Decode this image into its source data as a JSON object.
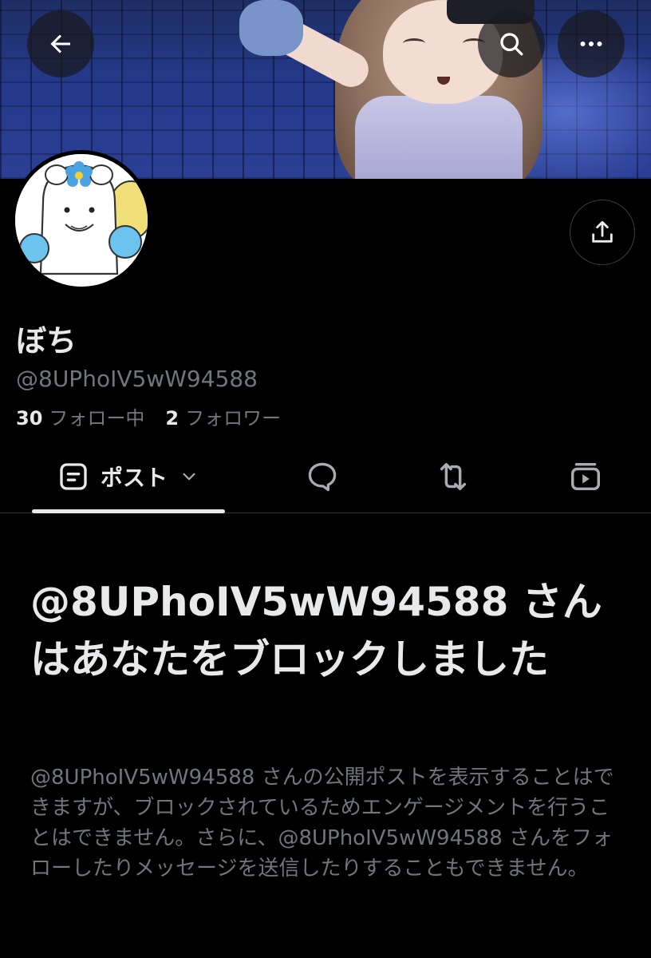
{
  "header": {
    "back_icon": "arrow-left-icon",
    "search_icon": "search-icon",
    "more_icon": "more-horizontal-icon"
  },
  "profile": {
    "display_name": "ぼち",
    "handle": "@8UPhoIV5wW94588",
    "following_count": "30",
    "following_label": "フォロー中",
    "followers_count": "2",
    "followers_label": "フォロワー",
    "share_icon": "share-icon"
  },
  "tabs": [
    {
      "label": "ポスト",
      "icon": "posts-icon",
      "active": true,
      "has_dropdown": true
    },
    {
      "label": "",
      "icon": "reply-bubble-icon",
      "active": false
    },
    {
      "label": "",
      "icon": "repost-icon",
      "active": false
    },
    {
      "label": "",
      "icon": "media-video-icon",
      "active": false
    }
  ],
  "block_notice": {
    "title": "@8UPhoIV5wW94588 さんはあなたをブロックしました",
    "body": "@8UPhoIV5wW94588 さんの公開ポストを表示することはできますが、ブロックされているためエンゲージメントを行うことはできません。さらに、@8UPhoIV5wW94588 さんをフォローしたりメッセージを送信したりすることもできません。"
  },
  "colors": {
    "background": "#000000",
    "primary_text": "#e7e9ea",
    "secondary_text": "#71767b",
    "divider": "#2f3336"
  }
}
